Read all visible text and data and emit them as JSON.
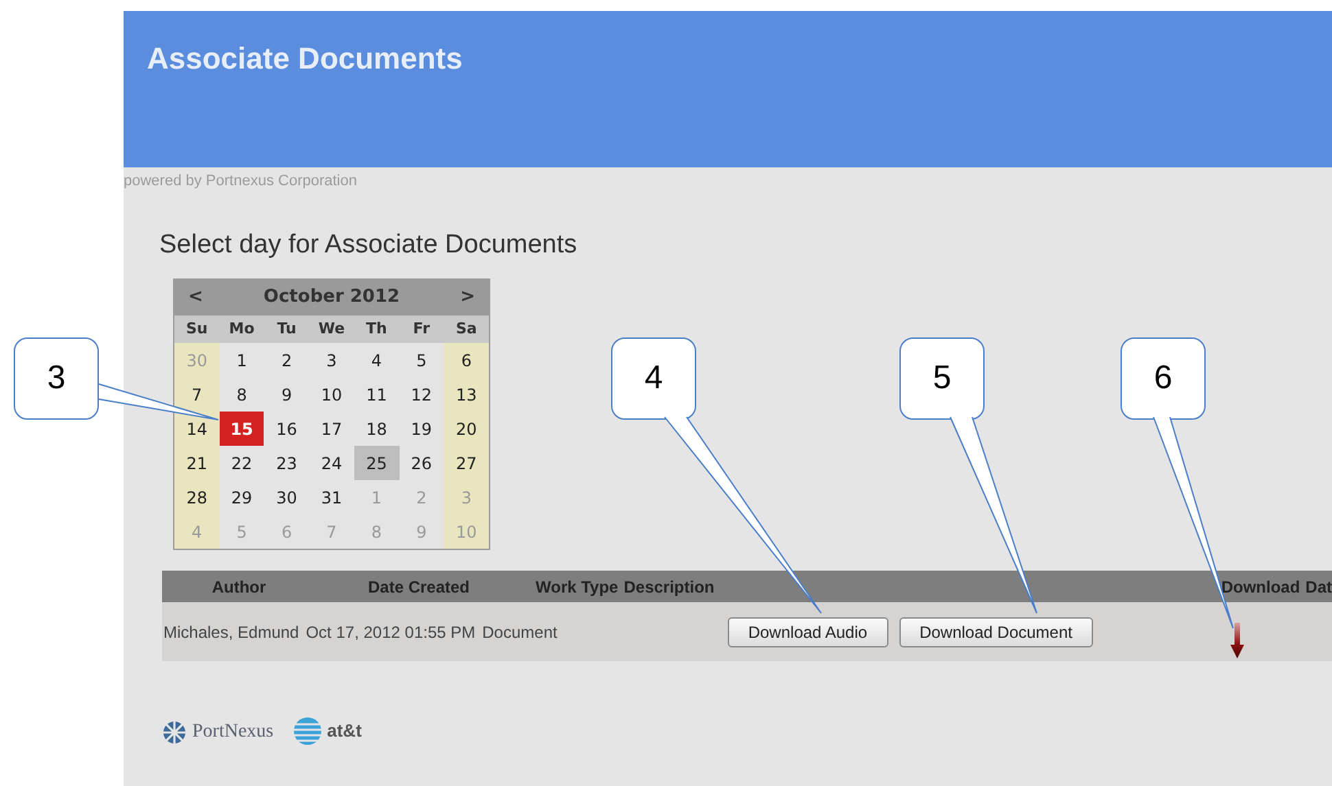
{
  "header": {
    "title": "Associate Documents"
  },
  "powered_by": "powered by Portnexus Corporation",
  "heading": "Select day for Associate Documents",
  "calendar": {
    "prev": "<",
    "next": ">",
    "month_label": "October 2012",
    "weekdays": [
      "Su",
      "Mo",
      "Tu",
      "We",
      "Th",
      "Fr",
      "Sa"
    ],
    "weeks": [
      [
        {
          "day": "30",
          "muted": true,
          "selected": false,
          "today": false
        },
        {
          "day": "1",
          "muted": false,
          "selected": false,
          "today": false
        },
        {
          "day": "2",
          "muted": false,
          "selected": false,
          "today": false
        },
        {
          "day": "3",
          "muted": false,
          "selected": false,
          "today": false
        },
        {
          "day": "4",
          "muted": false,
          "selected": false,
          "today": false
        },
        {
          "day": "5",
          "muted": false,
          "selected": false,
          "today": false
        },
        {
          "day": "6",
          "muted": false,
          "selected": false,
          "today": false
        }
      ],
      [
        {
          "day": "7",
          "muted": false,
          "selected": false,
          "today": false
        },
        {
          "day": "8",
          "muted": false,
          "selected": false,
          "today": false
        },
        {
          "day": "9",
          "muted": false,
          "selected": false,
          "today": false
        },
        {
          "day": "10",
          "muted": false,
          "selected": false,
          "today": false
        },
        {
          "day": "11",
          "muted": false,
          "selected": false,
          "today": false
        },
        {
          "day": "12",
          "muted": false,
          "selected": false,
          "today": false
        },
        {
          "day": "13",
          "muted": false,
          "selected": false,
          "today": false
        }
      ],
      [
        {
          "day": "14",
          "muted": false,
          "selected": false,
          "today": false
        },
        {
          "day": "15",
          "muted": false,
          "selected": true,
          "today": false
        },
        {
          "day": "16",
          "muted": false,
          "selected": false,
          "today": false
        },
        {
          "day": "17",
          "muted": false,
          "selected": false,
          "today": false
        },
        {
          "day": "18",
          "muted": false,
          "selected": false,
          "today": false
        },
        {
          "day": "19",
          "muted": false,
          "selected": false,
          "today": false
        },
        {
          "day": "20",
          "muted": false,
          "selected": false,
          "today": false
        }
      ],
      [
        {
          "day": "21",
          "muted": false,
          "selected": false,
          "today": false
        },
        {
          "day": "22",
          "muted": false,
          "selected": false,
          "today": false
        },
        {
          "day": "23",
          "muted": false,
          "selected": false,
          "today": false
        },
        {
          "day": "24",
          "muted": false,
          "selected": false,
          "today": false
        },
        {
          "day": "25",
          "muted": false,
          "selected": false,
          "today": true
        },
        {
          "day": "26",
          "muted": false,
          "selected": false,
          "today": false
        },
        {
          "day": "27",
          "muted": false,
          "selected": false,
          "today": false
        }
      ],
      [
        {
          "day": "28",
          "muted": false,
          "selected": false,
          "today": false
        },
        {
          "day": "29",
          "muted": false,
          "selected": false,
          "today": false
        },
        {
          "day": "30",
          "muted": false,
          "selected": false,
          "today": false
        },
        {
          "day": "31",
          "muted": false,
          "selected": false,
          "today": false
        },
        {
          "day": "1",
          "muted": true,
          "selected": false,
          "today": false
        },
        {
          "day": "2",
          "muted": true,
          "selected": false,
          "today": false
        },
        {
          "day": "3",
          "muted": true,
          "selected": false,
          "today": false
        }
      ],
      [
        {
          "day": "4",
          "muted": true,
          "selected": false,
          "today": false
        },
        {
          "day": "5",
          "muted": true,
          "selected": false,
          "today": false
        },
        {
          "day": "6",
          "muted": true,
          "selected": false,
          "today": false
        },
        {
          "day": "7",
          "muted": true,
          "selected": false,
          "today": false
        },
        {
          "day": "8",
          "muted": true,
          "selected": false,
          "today": false
        },
        {
          "day": "9",
          "muted": true,
          "selected": false,
          "today": false
        },
        {
          "day": "10",
          "muted": true,
          "selected": false,
          "today": false
        }
      ]
    ]
  },
  "table": {
    "columns": [
      "Author",
      "Date Created",
      "Work Type",
      "Description",
      "Download",
      "Dat"
    ],
    "rows": [
      {
        "author": "Michales, Edmund",
        "date_created": "Oct 17, 2012 01:55 PM",
        "work_type": "Document",
        "buttons": [
          "Download Audio",
          "Download Document"
        ]
      }
    ]
  },
  "footer": {
    "portnexus": "PortNexus",
    "att": "at&t"
  },
  "callouts": [
    {
      "label": "3"
    },
    {
      "label": "4"
    },
    {
      "label": "5"
    },
    {
      "label": "6"
    }
  ]
}
